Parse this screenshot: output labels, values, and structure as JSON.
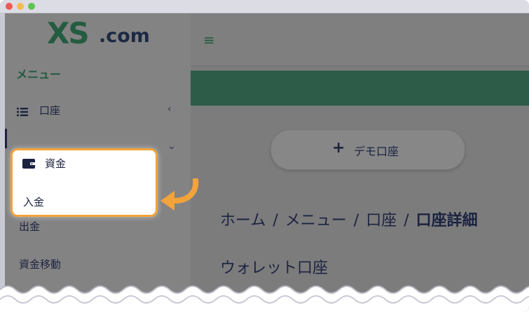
{
  "logo": {
    "brand": "XS",
    "suffix": ".com"
  },
  "sidebar": {
    "title": "メニュー",
    "items": [
      {
        "label": "口座",
        "icon": "list-icon",
        "chevron": "‹"
      },
      {
        "label": "資金",
        "icon": "wallet-icon",
        "chevron": "⌄"
      }
    ],
    "subitems": [
      "入金",
      "出金",
      "資金移動"
    ]
  },
  "main": {
    "demo_button": "デモ口座",
    "breadcrumb": [
      "ホーム",
      "メニュー",
      "口座",
      "口座詳細"
    ],
    "section_title": "ウォレット口座"
  },
  "colors": {
    "brand_green": "#245c41",
    "highlight": "#f2a33a",
    "navy": "#1b2340"
  }
}
